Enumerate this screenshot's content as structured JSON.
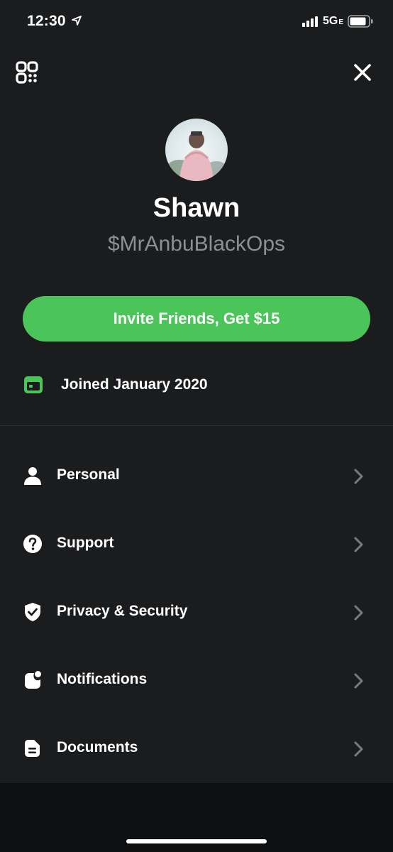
{
  "status_bar": {
    "time": "12:30",
    "network": "5G",
    "network_suffix": "E"
  },
  "profile": {
    "name": "Shawn",
    "cashtag": "$MrAnbuBlackOps"
  },
  "invite_button": {
    "label": "Invite Friends, Get $15"
  },
  "joined": {
    "label": "Joined January 2020",
    "icon": "calendar-icon",
    "icon_color": "#4bc55a"
  },
  "menu": {
    "items": [
      {
        "label": "Personal",
        "icon": "person-icon"
      },
      {
        "label": "Support",
        "icon": "question-icon"
      },
      {
        "label": "Privacy & Security",
        "icon": "shield-check-icon"
      },
      {
        "label": "Notifications",
        "icon": "notification-icon"
      },
      {
        "label": "Documents",
        "icon": "document-icon"
      }
    ]
  },
  "colors": {
    "background": "#1b1c1e",
    "accent_green": "#4bc55a",
    "secondary_text": "#8e8f93",
    "chevron": "#7a7b7f"
  }
}
